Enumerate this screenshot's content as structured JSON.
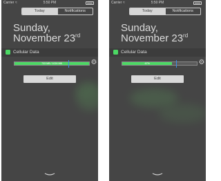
{
  "phones": [
    {
      "status_bar": {
        "carrier": "Carrier",
        "time": "5:50 PM"
      },
      "tabs": [
        {
          "label": "Today",
          "active": true
        },
        {
          "label": "Notifications",
          "active": false
        }
      ],
      "date_line1": "Sunday,",
      "date_line2": "November 23",
      "date_suffix": "rd",
      "widget": {
        "title": "Cellular Data",
        "icon": "app-icon",
        "bar_text": "733 MB / 1024 MB",
        "fill_fraction": 1.0,
        "marker_fraction": 0.72,
        "settings_icon": "gear-icon"
      },
      "edit_label": "Edit"
    },
    {
      "status_bar": {
        "carrier": "Carrier",
        "time": "5:50 PM"
      },
      "tabs": [
        {
          "label": "Today",
          "active": true
        },
        {
          "label": "Notifications",
          "active": false
        }
      ],
      "date_line1": "Sunday,",
      "date_line2": "November 23",
      "date_suffix": "rd",
      "widget": {
        "title": "Cellular Data",
        "icon": "app-icon",
        "bar_text": "67%",
        "fill_fraction": 0.67,
        "marker_fraction": 0.72,
        "settings_icon": "gear-icon"
      },
      "edit_label": "Edit"
    }
  ],
  "colors": {
    "panel_background": "#454545",
    "accent_green": "#4cd964",
    "marker_blue": "#3a8ee6"
  }
}
